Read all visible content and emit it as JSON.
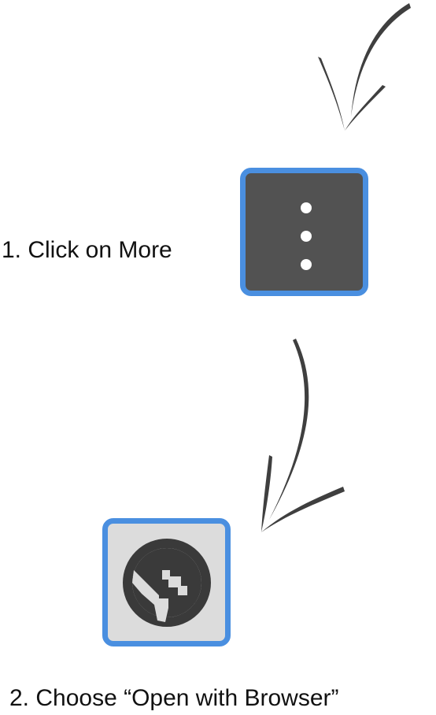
{
  "steps": [
    {
      "label": "1. Click on More"
    },
    {
      "label": "2. Choose “Open with Browser”"
    }
  ],
  "icons": {
    "more": "more-vertical-icon",
    "browser": "globe-icon"
  },
  "colors": {
    "highlight_border": "#4a8fe0",
    "more_background": "#525252",
    "browser_background": "#dcdcdc",
    "icon_fill": "#3a3a3a",
    "arrow": "#3f3f3f"
  }
}
